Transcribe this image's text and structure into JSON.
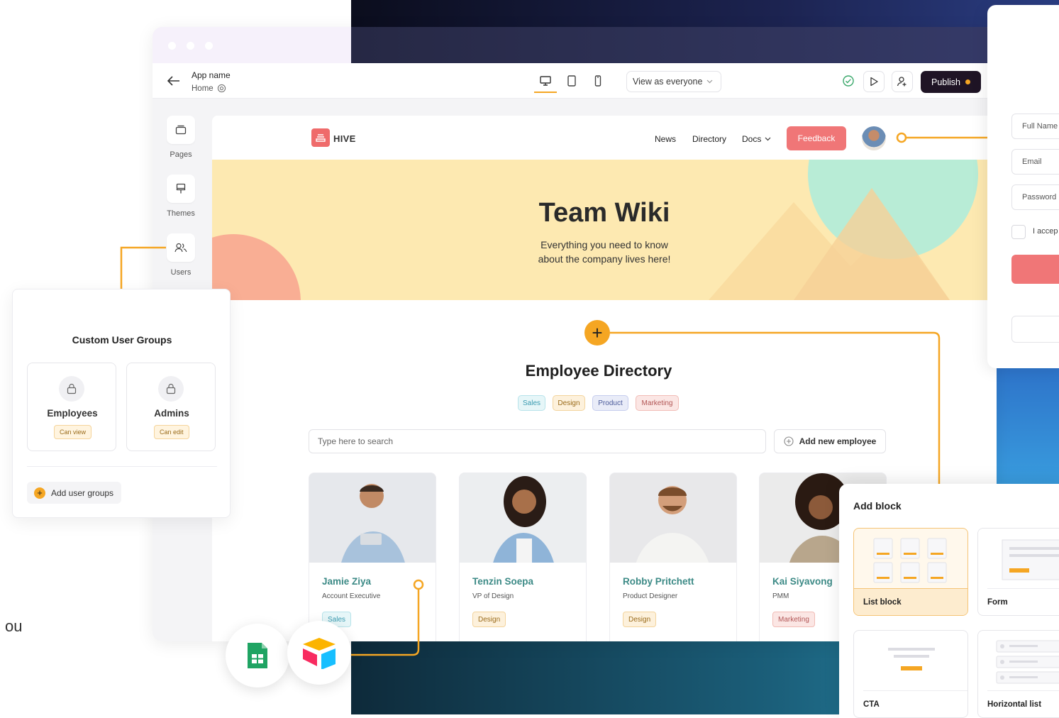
{
  "app": {
    "name": "App name",
    "page": "Home"
  },
  "toolbar": {
    "view_select": "View as everyone",
    "publish_label": "Publish"
  },
  "sidebar": {
    "items": [
      {
        "label": "Pages",
        "icon": "pages-icon"
      },
      {
        "label": "Themes",
        "icon": "themes-icon"
      },
      {
        "label": "Users",
        "icon": "users-icon"
      }
    ]
  },
  "site": {
    "logo_text": "HIVE",
    "nav": [
      "News",
      "Directory",
      "Docs"
    ],
    "feedback_label": "Feedback",
    "hero_title": "Team Wiki",
    "hero_subtitle_line1": "Everything you need to know",
    "hero_subtitle_line2": "about the company lives here!",
    "directory_title": "Employee Directory",
    "filters": [
      {
        "label": "Sales",
        "color": "#3a9bb0",
        "bg": "#e6f6f8"
      },
      {
        "label": "Design",
        "color": "#9a6b1a",
        "bg": "#fdf1dc"
      },
      {
        "label": "Product",
        "color": "#4a5a9a",
        "bg": "#e9ecf8"
      },
      {
        "label": "Marketing",
        "color": "#b25656",
        "bg": "#fbe6e4"
      }
    ],
    "search_placeholder": "Type here to search",
    "add_employee_label": "Add new employee",
    "employees": [
      {
        "name": "Jamie Ziya",
        "role": "Account Executive",
        "tag": "Sales"
      },
      {
        "name": "Tenzin Soepa",
        "role": "VP of Design",
        "tag": "Design"
      },
      {
        "name": "Robby Pritchett",
        "role": "Product Designer",
        "tag": "Design"
      },
      {
        "name": "Kai Siyavong",
        "role": "PMM",
        "tag": "Marketing"
      }
    ]
  },
  "groups_panel": {
    "title": "Custom User Groups",
    "groups": [
      {
        "name": "Employees",
        "permission": "Can view"
      },
      {
        "name": "Admins",
        "permission": "Can edit"
      }
    ],
    "add_label": "Add user groups"
  },
  "signup_panel": {
    "fields": [
      "Full Name",
      "Email",
      "Password"
    ],
    "accept_text": "I accep"
  },
  "add_block_panel": {
    "title": "Add block",
    "blocks": [
      "List block",
      "Form",
      "CTA",
      "Horizontal list"
    ]
  },
  "integrations": [
    "google-sheets-icon",
    "airtable-icon"
  ],
  "fragment_text": "ou",
  "colors": {
    "accent": "#f5a623",
    "brand_red": "#f07677",
    "publish_bg": "#1f1425",
    "hero_bg": "#fde9b1",
    "name_teal": "#3c8a86"
  }
}
